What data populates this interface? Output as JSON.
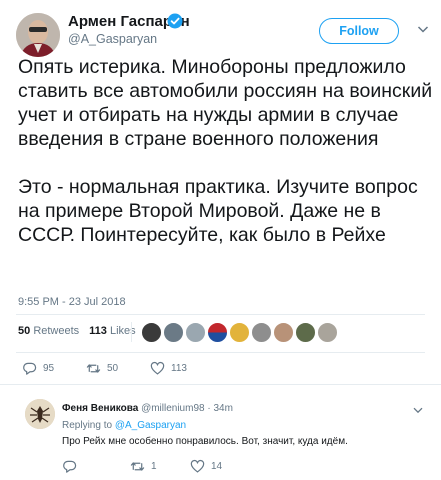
{
  "tweet": {
    "author_name": "Армен Гаспарян",
    "author_handle": "@A_Gasparyan",
    "follow_label": "Follow",
    "paragraphs": [
      "Опять истерика. Минобороны предложило ставить все автомобили россиян на воинский учет и отбирать на нужды армии в случае введения в стране военного положения",
      "Это - нормальная практика. Изучите вопрос на примере Второй Мировой. Даже не в СССР. Поинтересуйте, как было в Рейхе"
    ],
    "timestamp": "9:55 PM - 23 Jul 2018",
    "retweets_count": "50",
    "retweets_label": "Retweets",
    "likes_count": "113",
    "likes_label": "Likes",
    "action_counts": {
      "reply": "95",
      "retweet": "50",
      "like": "113"
    },
    "icons": [
      "verified-badge-icon",
      "chevron-down-icon",
      "reply-icon",
      "retweet-icon",
      "heart-icon"
    ],
    "colors": {
      "accent": "#1da1f2",
      "muted": "#657786",
      "divider": "#e6ecf0"
    }
  },
  "reply": {
    "author_name": "Феня Веникова",
    "author_handle": "@millenium98",
    "separator": "·",
    "time": "34m",
    "replying_prefix": "Replying to",
    "replying_to": "@A_Gasparyan",
    "text": "Про Рейх мне особенно понравилось. Вот, значит, куда идём.",
    "action_counts": {
      "reply": "",
      "retweet": "1",
      "like": "14"
    }
  }
}
